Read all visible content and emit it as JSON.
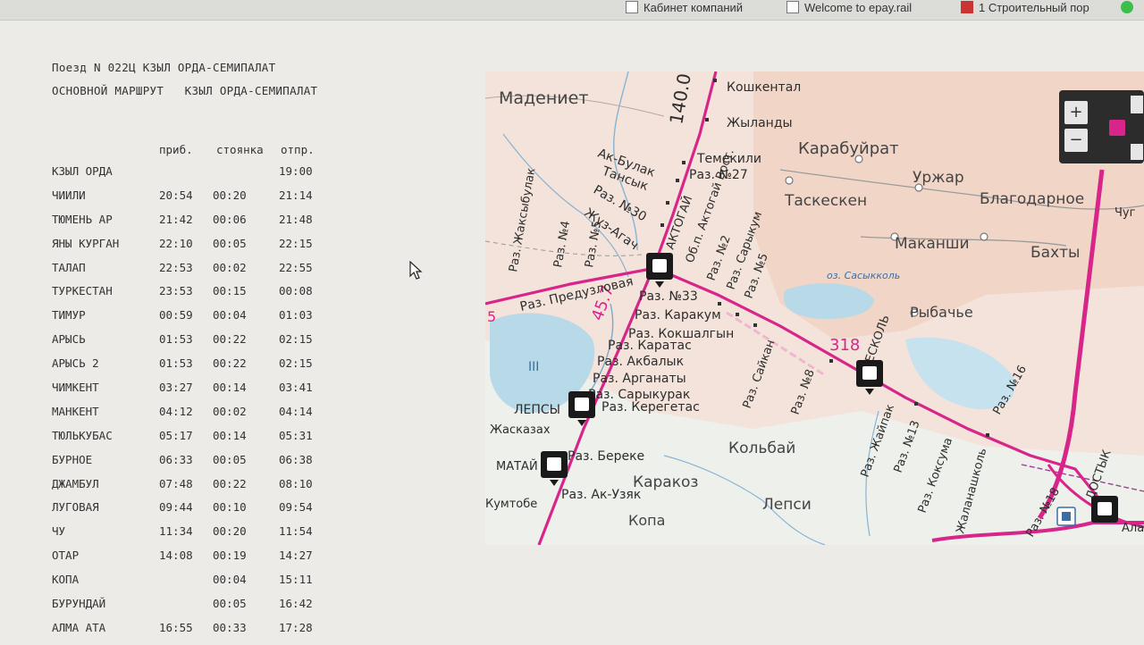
{
  "browser": {
    "tabs": [
      {
        "label": "Кабинет компаний"
      },
      {
        "label": "Welcome to epay.rail"
      },
      {
        "label": "1 Строительный пор"
      }
    ]
  },
  "schedule": {
    "header_line1": "Поезд N 022Ц КЗЫЛ ОРДА-СЕМИПАЛАТ",
    "header_line2": "ОСНОВНОЙ МАРШРУТ   КЗЫЛ ОРДА-СЕМИПАЛАТ",
    "columns": {
      "arrival": "приб.",
      "stop": "стоянка",
      "departure": "отпр."
    },
    "rows": [
      {
        "station": "КЗЫЛ ОРДА",
        "arr": "",
        "stop": "",
        "dep": "19:00"
      },
      {
        "station": "ЧИИЛИ",
        "arr": "20:54",
        "stop": "00:20",
        "dep": "21:14"
      },
      {
        "station": "ТЮМЕНЬ АР",
        "arr": "21:42",
        "stop": "00:06",
        "dep": "21:48"
      },
      {
        "station": "ЯНЫ КУРГАН",
        "arr": "22:10",
        "stop": "00:05",
        "dep": "22:15"
      },
      {
        "station": "ТАЛАП",
        "arr": "22:53",
        "stop": "00:02",
        "dep": "22:55"
      },
      {
        "station": "ТУРКЕСТАН",
        "arr": "23:53",
        "stop": "00:15",
        "dep": "00:08"
      },
      {
        "station": "ТИМУР",
        "arr": "00:59",
        "stop": "00:04",
        "dep": "01:03"
      },
      {
        "station": "АРЫСЬ",
        "arr": "01:53",
        "stop": "00:22",
        "dep": "02:15"
      },
      {
        "station": "АРЫСЬ 2",
        "arr": "01:53",
        "stop": "00:22",
        "dep": "02:15"
      },
      {
        "station": "ЧИМКЕНТ",
        "arr": "03:27",
        "stop": "00:14",
        "dep": "03:41"
      },
      {
        "station": "МАНКЕНТ",
        "arr": "04:12",
        "stop": "00:02",
        "dep": "04:14"
      },
      {
        "station": "ТЮЛЬКУБАС",
        "arr": "05:17",
        "stop": "00:14",
        "dep": "05:31"
      },
      {
        "station": "БУРНОЕ",
        "arr": "06:33",
        "stop": "00:05",
        "dep": "06:38"
      },
      {
        "station": "ДЖАМБУЛ",
        "arr": "07:48",
        "stop": "00:22",
        "dep": "08:10"
      },
      {
        "station": "ЛУГОВАЯ",
        "arr": "09:44",
        "stop": "00:10",
        "dep": "09:54"
      },
      {
        "station": "ЧУ",
        "arr": "11:34",
        "stop": "00:20",
        "dep": "11:54"
      },
      {
        "station": "ОТАР",
        "arr": "14:08",
        "stop": "00:19",
        "dep": "14:27"
      },
      {
        "station": "КОПА",
        "arr": "",
        "stop": "00:04",
        "dep": "15:11"
      },
      {
        "station": "БУРУНДАЙ",
        "arr": "",
        "stop": "00:05",
        "dep": "16:42"
      },
      {
        "station": "АЛМА АТА",
        "arr": "16:55",
        "stop": "00:33",
        "dep": "17:28"
      }
    ]
  },
  "map": {
    "km_labels": {
      "k140": "140.0",
      "k45": "45.7",
      "k318": "318"
    },
    "places": {
      "madeniet": "Мадениет",
      "koshkental": "Кошкентал",
      "zhylandy": "Жыланды",
      "karabuirat": "Карабуйрат",
      "temekili": "Темекили",
      "razd27": "Раз. №27",
      "akbulak": "Ак-Булак",
      "tansyk": "Тансык",
      "razd30": "Раз. №30",
      "zhuzagach": "Жуз-Агач",
      "aktogai": "АКТОГАЙ",
      "aktogai_vost": "Об.п. Актогай Вост.",
      "razd2": "Раз. №2",
      "sarykum": "Раз. Сарыкум",
      "razd5b": "Раз. №5",
      "taskesken": "Таскескен",
      "urzhar": "Уржар",
      "blagodarnoe": "Благодарное",
      "makanshi": "Маканши",
      "bakhty": "Бахты",
      "chug": "Чуг",
      "sasykkol": "оз. Сасыкколь",
      "rybachye": "Рыбачье",
      "beskol": "БЕСКОЛЬ",
      "razd33": "Раз. №33",
      "karakum": "Раз. Каракум",
      "koshkalgyn": "Раз. Кокшалгын",
      "karatas": "Раз. Каратас",
      "akbalyk": "Раз. Акбалык",
      "arganaty": "Раз. Арганаты",
      "sarykurak": "Раз. Сарыкурак",
      "keregetas": "Раз. Керегетас",
      "lepsy": "ЛЕПСЫ",
      "zhaskazakh": "Жасказах",
      "matai": "МАТАЙ",
      "bereke": "Раз. Береке",
      "akuzyak": "Раз. Ак-Узяк",
      "kumtobe": "Кумтобе",
      "karakoz": "Каракоз",
      "kopa": "Копа",
      "kolbai": "Кольбай",
      "lepsi": "Лепси",
      "saikan": "Раз. Сайкан",
      "razd8": "Раз. №8",
      "zhaipak": "Раз. Жайпак",
      "razd13": "Раз. №13",
      "kokuma": "Раз. Коксума",
      "zhalanashkol": "Жаланашколь",
      "razd16": "Раз. №16",
      "razd18": "Раз. №18",
      "dostyk": "ДОСТЫК",
      "zhaksybulak": "Раз. Жаксыбулак",
      "razd4": "Раз. №4",
      "razd5": "Раз. №5",
      "preduzlovaya": "Раз. Предузловая",
      "alakol": "Ала",
      "num5": "5",
      "num3": "III"
    },
    "zoom_in": "+",
    "zoom_out": "−",
    "colors": {
      "railway": "#d8258a",
      "land": "#f4ddd2",
      "water": "#b7d9e8",
      "road": "#cc3399"
    }
  }
}
